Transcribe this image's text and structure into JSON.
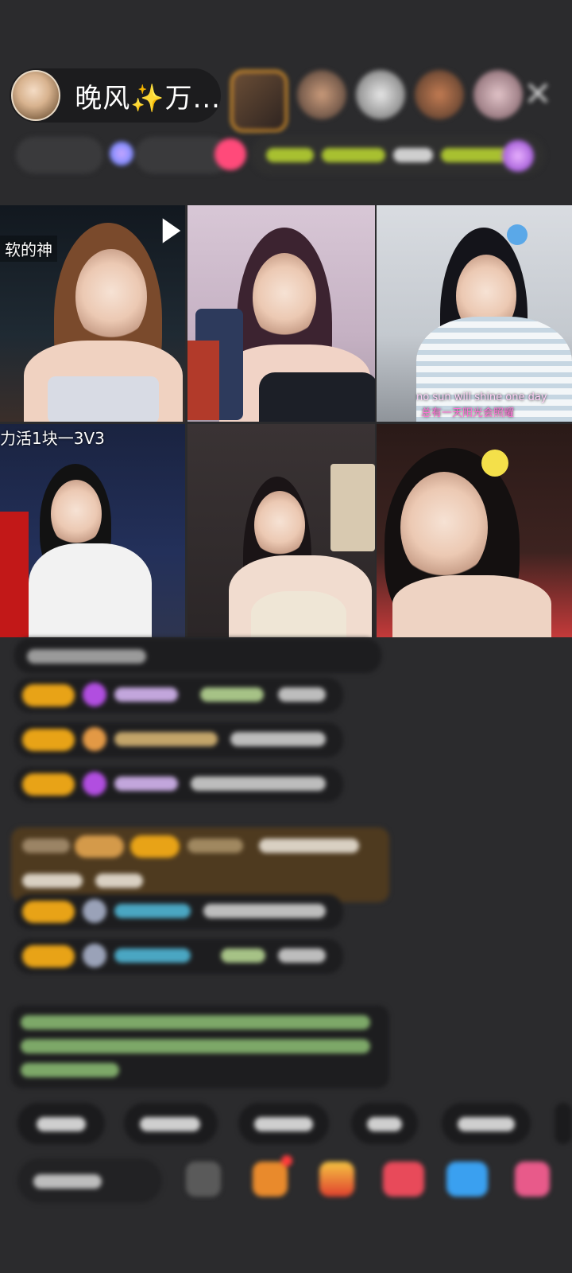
{
  "host": {
    "name": "晚风✨万..."
  },
  "icons": {
    "close": "close-icon"
  },
  "tiles": [
    {
      "label": "软的神"
    },
    {
      "label": ""
    },
    {
      "label": "no sun will shine one day",
      "sub": "总有一天阳光会照耀"
    },
    {
      "label": "力活1块一3V3"
    },
    {
      "label": ""
    },
    {
      "label": ""
    }
  ]
}
